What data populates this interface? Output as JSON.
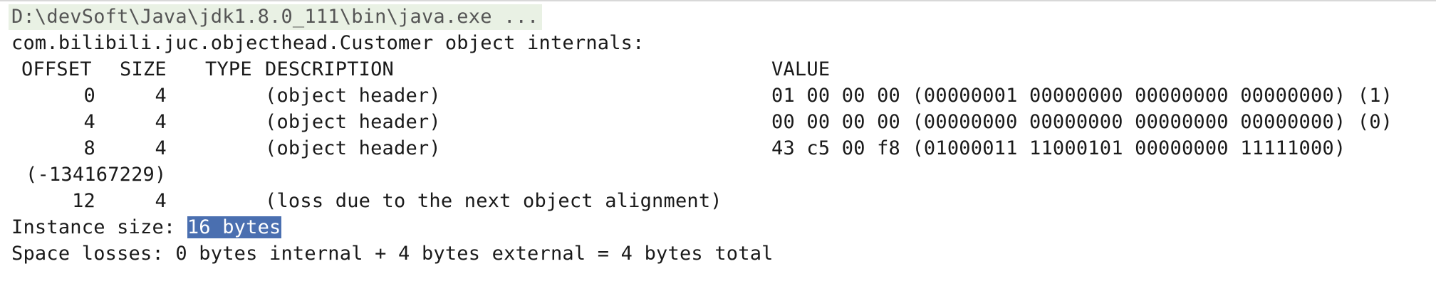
{
  "console": {
    "command": "D:\\devSoft\\Java\\jdk1.8.0_111\\bin\\java.exe ...",
    "internals_title": "com.bilibili.juc.objecthead.Customer object internals:",
    "headers": {
      "offset": "OFFSET",
      "size": "SIZE",
      "type": "TYPE",
      "description": "DESCRIPTION",
      "value": "VALUE"
    },
    "rows": [
      {
        "offset": "0",
        "size": "4",
        "type": "",
        "description": "(object header)",
        "value": "01 00 00 00 (00000001 00000000 00000000 00000000) (1)"
      },
      {
        "offset": "4",
        "size": "4",
        "type": "",
        "description": "(object header)",
        "value": "00 00 00 00 (00000000 00000000 00000000 00000000) (0)"
      },
      {
        "offset": "8",
        "size": "4",
        "type": "",
        "description": "(object header)",
        "value": "43 c5 00 f8 (01000011 11000101 00000000 11111000)"
      },
      {
        "offset": "12",
        "size": "4",
        "type": "",
        "description": "(loss due to the next object alignment)",
        "value": ""
      }
    ],
    "wrapped_value": "(-134167229)",
    "instance_size_label": "Instance size: ",
    "instance_size_value": "16 bytes",
    "space_losses": "Space losses: 0 bytes internal + 4 bytes external = 4 bytes total"
  }
}
